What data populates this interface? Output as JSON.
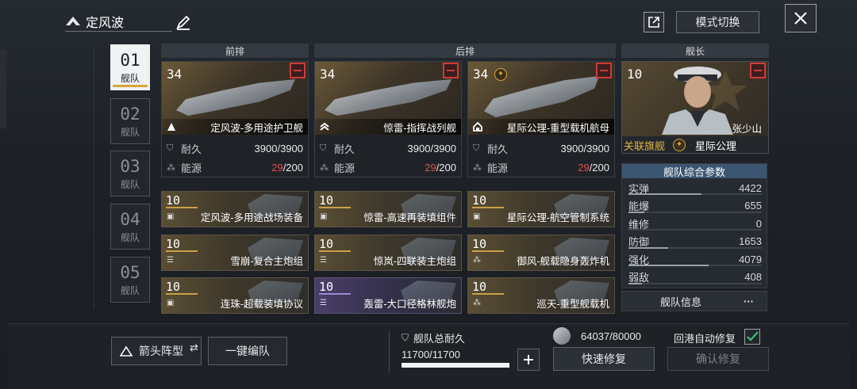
{
  "header": {
    "fleet_name": "定风波",
    "mode_switch_label": "模式切换"
  },
  "tabs": [
    {
      "num": "01",
      "label": "舰队",
      "active": true
    },
    {
      "num": "02",
      "label": "舰队",
      "active": false
    },
    {
      "num": "03",
      "label": "舰队",
      "active": false
    },
    {
      "num": "04",
      "label": "舰队",
      "active": false
    },
    {
      "num": "05",
      "label": "舰队",
      "active": false
    }
  ],
  "sections": {
    "front": "前排",
    "back": "后排",
    "captain": "舰长"
  },
  "ships": [
    {
      "level": "34",
      "name": "定风波-多用途护卫舰",
      "type_icon": "triangle-icon",
      "durability_label": "耐久",
      "durability": "3900/3900",
      "energy_label": "能源",
      "energy_used": "29",
      "energy_total": "/200"
    },
    {
      "level": "34",
      "name": "惊雷-指挥战列舰",
      "type_icon": "chevron-stack-icon",
      "durability_label": "耐久",
      "durability": "3900/3900",
      "energy_label": "能源",
      "energy_used": "29",
      "energy_total": "/200"
    },
    {
      "level": "34",
      "name": "星际公理-重型载机航母",
      "type_icon": "carrier-icon",
      "has_badge": true,
      "durability_label": "耐久",
      "durability": "3900/3900",
      "energy_label": "能源",
      "energy_used": "29",
      "energy_total": "/200"
    }
  ],
  "equipment": [
    [
      {
        "level": "10",
        "name": "定风波-多用途战场装备",
        "icon": "module-icon",
        "rarity": "gold"
      },
      {
        "level": "10",
        "name": "雪崩-复合主炮组",
        "icon": "list-icon",
        "rarity": "gold"
      },
      {
        "level": "10",
        "name": "连珠-超载装填协议",
        "icon": "module-icon",
        "rarity": "gold"
      }
    ],
    [
      {
        "level": "10",
        "name": "惊雷-高速再装填组件",
        "icon": "module-icon",
        "rarity": "gold"
      },
      {
        "level": "10",
        "name": "惊岚-四联装主炮组",
        "icon": "list-icon",
        "rarity": "gold"
      },
      {
        "level": "10",
        "name": "轰雷-大口径格林舰炮",
        "icon": "list-icon",
        "rarity": "purple"
      }
    ],
    [
      {
        "level": "10",
        "name": "星际公理-航空管制系统",
        "icon": "module-icon",
        "rarity": "gold"
      },
      {
        "level": "10",
        "name": "御风-舰载隐身轰炸机",
        "icon": "aircraft-icon",
        "rarity": "gold"
      },
      {
        "level": "10",
        "name": "巡天-重型舰载机",
        "icon": "aircraft-icon",
        "rarity": "gold"
      }
    ]
  ],
  "captain": {
    "level": "10",
    "name": "张少山",
    "flagship_label": "关联旗舰",
    "flagship_name": "星际公理"
  },
  "params": {
    "title": "舰队综合参数",
    "rows": [
      {
        "label": "实弹",
        "value": "4422",
        "fill": 0.55
      },
      {
        "label": "能爆",
        "value": "655",
        "fill": 0.12
      },
      {
        "label": "维修",
        "value": "0",
        "fill": 0.0
      },
      {
        "label": "防御",
        "value": "1653",
        "fill": 0.3
      },
      {
        "label": "强化",
        "value": "4079",
        "fill": 0.6
      },
      {
        "label": "弱敌",
        "value": "408",
        "fill": 0.1
      }
    ],
    "info_label": "舰队信息",
    "more_label": "···"
  },
  "bottom": {
    "formation_label": "箭头阵型",
    "auto_form_label": "一键编队",
    "total_durability_label": "舰队总耐久",
    "total_durability_value": "11700/11700",
    "total_durability_fill": 1.0,
    "repair_resource": "64037/80000",
    "quick_repair_label": "快速修复",
    "auto_repair_label": "回港自动修复",
    "auto_repair_checked": true,
    "confirm_repair_label": "确认修复"
  }
}
